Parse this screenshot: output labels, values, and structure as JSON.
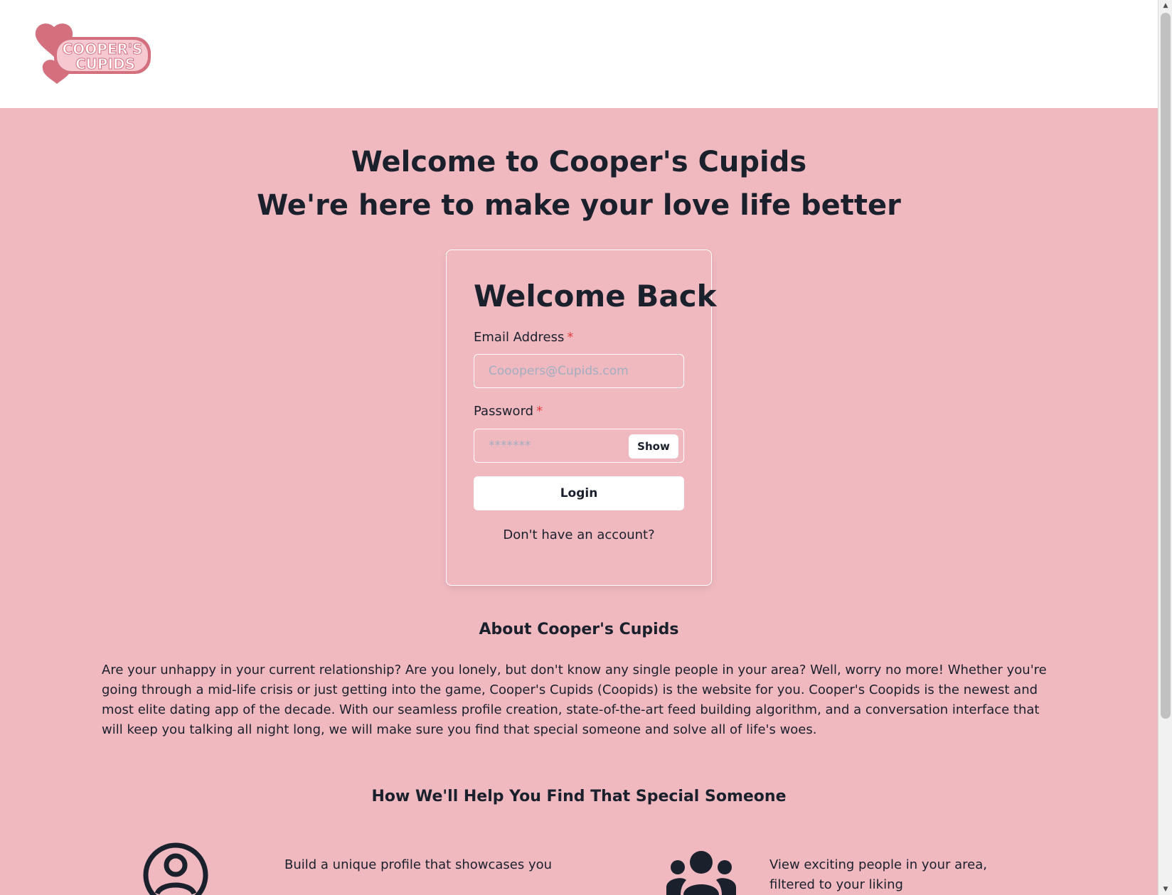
{
  "header": {
    "logo_text_line1": "COOPER'S",
    "logo_text_line2": "CUPIDS"
  },
  "hero": {
    "title_line1": "Welcome to Cooper's Cupids",
    "title_line2": "We're here to make your love life better"
  },
  "login": {
    "title": "Welcome Back",
    "email_label": "Email Address",
    "email_placeholder": "Cooopers@Cupids.com",
    "password_label": "Password",
    "password_placeholder": "*******",
    "required_mark": "*",
    "show_label": "Show",
    "login_label": "Login",
    "signup_link": "Don't have an account?"
  },
  "about": {
    "heading": "About Cooper's Cupids",
    "body": "Are your unhappy in your current relationship? Are you lonely, but don't know any single people in your area? Well, worry no more! Whether you're going through a mid-life crisis or just getting into the game, Cooper's Cupids (Coopids) is the website for you. Cooper's Coopids is the newest and most elite dating app of the decade. With our seamless profile creation, state-of-the-art feed building algorithm, and a conversation interface that will keep you talking all night long, we will make sure you find that special someone and solve all of life's woes."
  },
  "features": {
    "heading": "How We'll Help You Find That Special Someone",
    "items": [
      {
        "icon": "user-circle-icon",
        "text": "Build a unique profile that showcases you"
      },
      {
        "icon": "users-group-icon",
        "text": "View exciting people in your area, filtered to your liking"
      }
    ]
  },
  "colors": {
    "background": "#f0b9c0",
    "header": "#ffffff",
    "text": "#1a202c",
    "required": "#e53e3e",
    "logo_pink": "#d4707e"
  }
}
